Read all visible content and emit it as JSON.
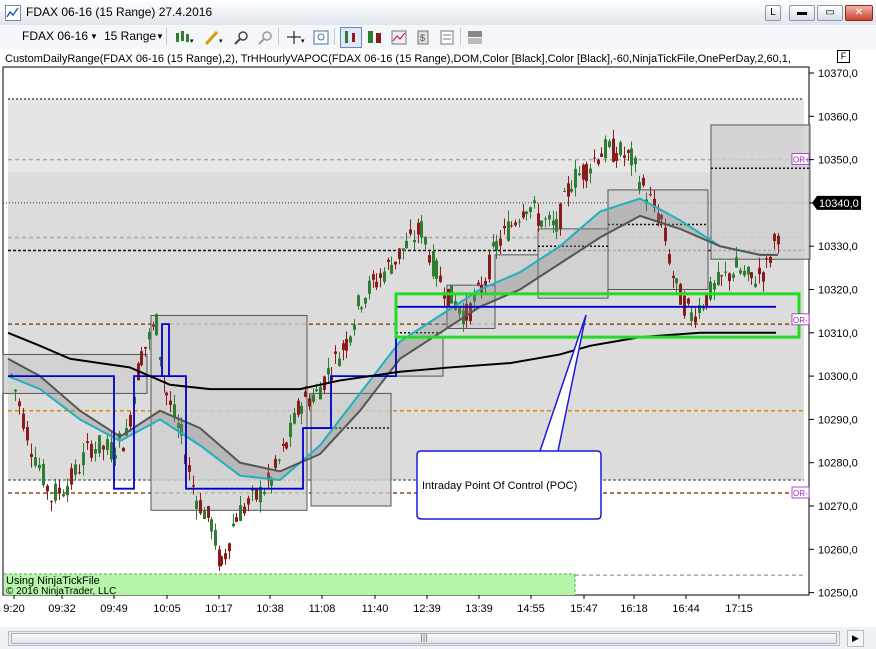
{
  "window": {
    "title": "FDAX 06-16 (15 Range)  27.4.2016",
    "buttons": {
      "restore_small": "L",
      "minimize": "▬",
      "maximize": "▭",
      "close": "✕"
    }
  },
  "toolbar": {
    "instrument": "FDAX 06-16",
    "interval": "15 Range",
    "tools": [
      "bar-type-icon",
      "pencil-icon",
      "zoom-in-icon",
      "zoom-out-icon",
      "crosshair-icon",
      "magnifier-icon",
      "data-box-icon",
      "chart-style-icon",
      "properties-icon",
      "strategy-icon",
      "indicators-icon",
      "panel-icon"
    ]
  },
  "chart": {
    "indicator_label": "CustomDailyRange(FDAX 06-16 (15 Range),2), TrHHourlyVAPOC(FDAX 06-16 (15 Range),DOM,Color [Black],Color [Black],-60,NinjaTickFile,OnePerDay,2,60,1,",
    "f_button": "F",
    "y_ticks": [
      "10370,0",
      "10360,0",
      "10350,0",
      "10340,0",
      "10330,0",
      "10320,0",
      "10310,0",
      "10300,0",
      "10290,0",
      "10280,0",
      "10270,0",
      "10260,0",
      "10250,0"
    ],
    "y_values": [
      10370,
      10360,
      10350,
      10340,
      10330,
      10320,
      10310,
      10300,
      10290,
      10280,
      10270,
      10260,
      10250
    ],
    "current_price": "10340,0",
    "x_ticks": [
      "9:20",
      "09:32",
      "09:49",
      "10:05",
      "10:17",
      "10:38",
      "11:08",
      "11:40",
      "12:39",
      "13:39",
      "14:55",
      "15:47",
      "16:18",
      "16:44",
      "17:15"
    ],
    "or_labels": [
      "OR+",
      "OR-",
      "OR-"
    ],
    "annotation": "Intraday Point Of Control (POC)",
    "footer_line1": "Using NinjaTickFile",
    "footer_line2": "© 2016 NinjaTrader, LLC",
    "colors": {
      "range_box": "#d4d4d4",
      "poc_highlight": "#22dd22",
      "vapoc": "#0000cc",
      "sma_fast": "#20b0c0",
      "sma_slow": "#555555",
      "up_candle": "#2e7d32",
      "down_candle": "#8b1a1a",
      "level_orange": "#e08a00",
      "level_brown": "#8b4513",
      "or_label": "#a020c0",
      "footer_bg": "#b5f5a8"
    }
  },
  "scrollbar": {
    "grip": "|||",
    "right_arrow": "▶"
  }
}
